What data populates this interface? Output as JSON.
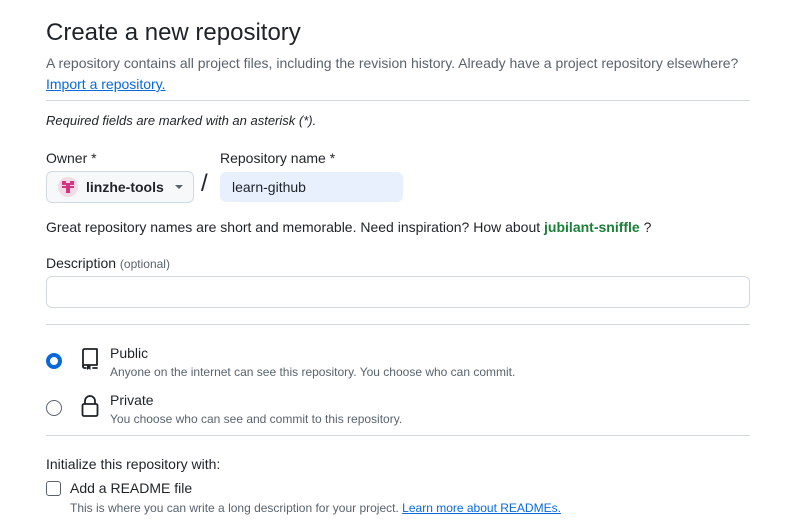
{
  "header": {
    "title": "Create a new repository",
    "subtitle": "A repository contains all project files, including the revision history. Already have a project repository elsewhere?",
    "import_link": "Import a repository."
  },
  "required_note": "Required fields are marked with an asterisk (*).",
  "owner": {
    "label": "Owner *",
    "value": "linzhe-tools",
    "avatar_icon": "identicon-avatar"
  },
  "separator": "/",
  "repo_name": {
    "label": "Repository name *",
    "value": "learn-github"
  },
  "name_hint": {
    "text": "Great repository names are short and memorable. Need inspiration? How about ",
    "suggestion": "jubilant-sniffle",
    "suffix": " ?"
  },
  "description": {
    "label": "Description",
    "optional": "(optional)",
    "value": "",
    "placeholder": ""
  },
  "visibility": {
    "selected": "public",
    "options": [
      {
        "id": "public",
        "title": "Public",
        "description": "Anyone on the internet can see this repository. You choose who can commit.",
        "icon": "repo-icon"
      },
      {
        "id": "private",
        "title": "Private",
        "description": "You choose who can see and commit to this repository.",
        "icon": "lock-icon"
      }
    ]
  },
  "initialize": {
    "title": "Initialize this repository with:",
    "readme_label": "Add a README file",
    "readme_checked": false,
    "readme_desc": "This is where you can write a long description for your project.",
    "readme_link": "Learn more about READMEs."
  },
  "colors": {
    "accent": "#0969da",
    "suggestion": "#1a7f37",
    "muted": "#59636e",
    "border": "#d1d9e0",
    "autofill": "#e8f0fe"
  }
}
